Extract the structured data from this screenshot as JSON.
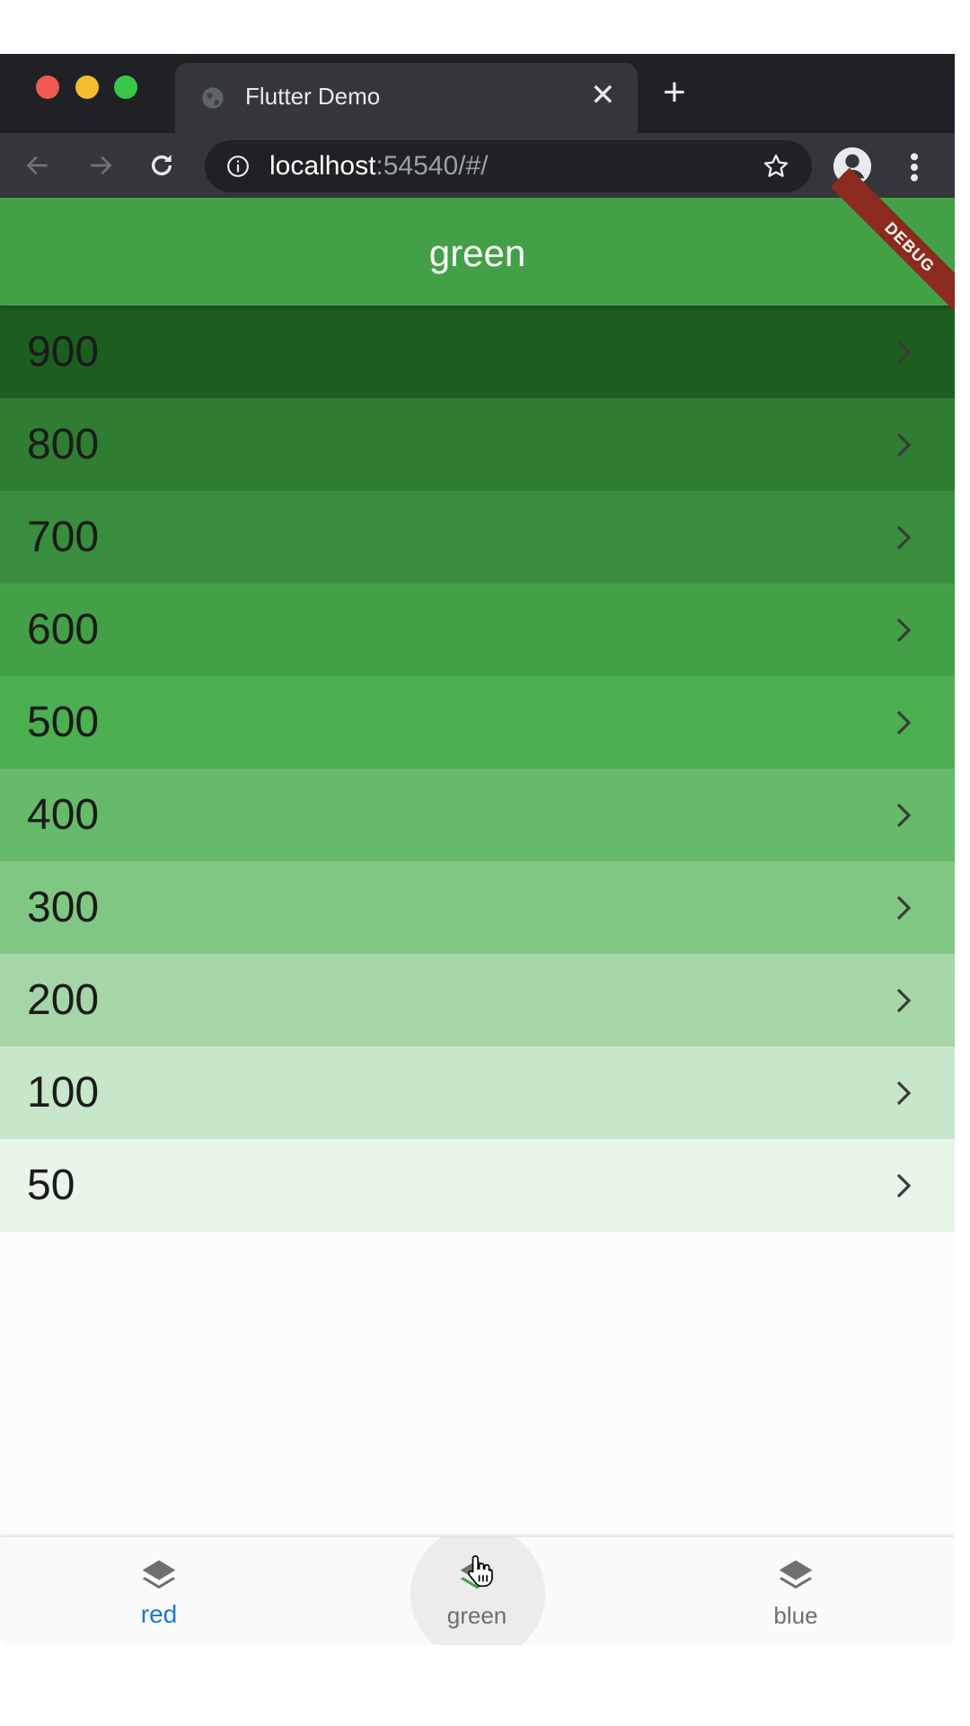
{
  "browser": {
    "tab_title": "Flutter Demo",
    "tab_close": "✕",
    "new_tab": "+",
    "url_host": "localhost",
    "url_rest": ":54540/#/"
  },
  "app": {
    "title": "green",
    "debug_banner": "DEBUG",
    "rows": [
      {
        "label": "900",
        "color": "#1b5e20"
      },
      {
        "label": "800",
        "color": "#2e7d32"
      },
      {
        "label": "700",
        "color": "#388e3c"
      },
      {
        "label": "600",
        "color": "#43a047"
      },
      {
        "label": "500",
        "color": "#4caf50"
      },
      {
        "label": "400",
        "color": "#66bb6a"
      },
      {
        "label": "300",
        "color": "#81c784"
      },
      {
        "label": "200",
        "color": "#a5d6a7"
      },
      {
        "label": "100",
        "color": "#c8e6c9"
      },
      {
        "label": "50",
        "color": "#e8f5e9"
      }
    ],
    "bottom_nav": [
      {
        "label": "red",
        "icon": "layers-icon",
        "active": true
      },
      {
        "label": "green",
        "icon": "layers-icon",
        "active": false
      },
      {
        "label": "blue",
        "icon": "layers-icon",
        "active": false
      }
    ],
    "colors": {
      "appbar": "#43a047",
      "active_nav": "#1976d2"
    }
  }
}
